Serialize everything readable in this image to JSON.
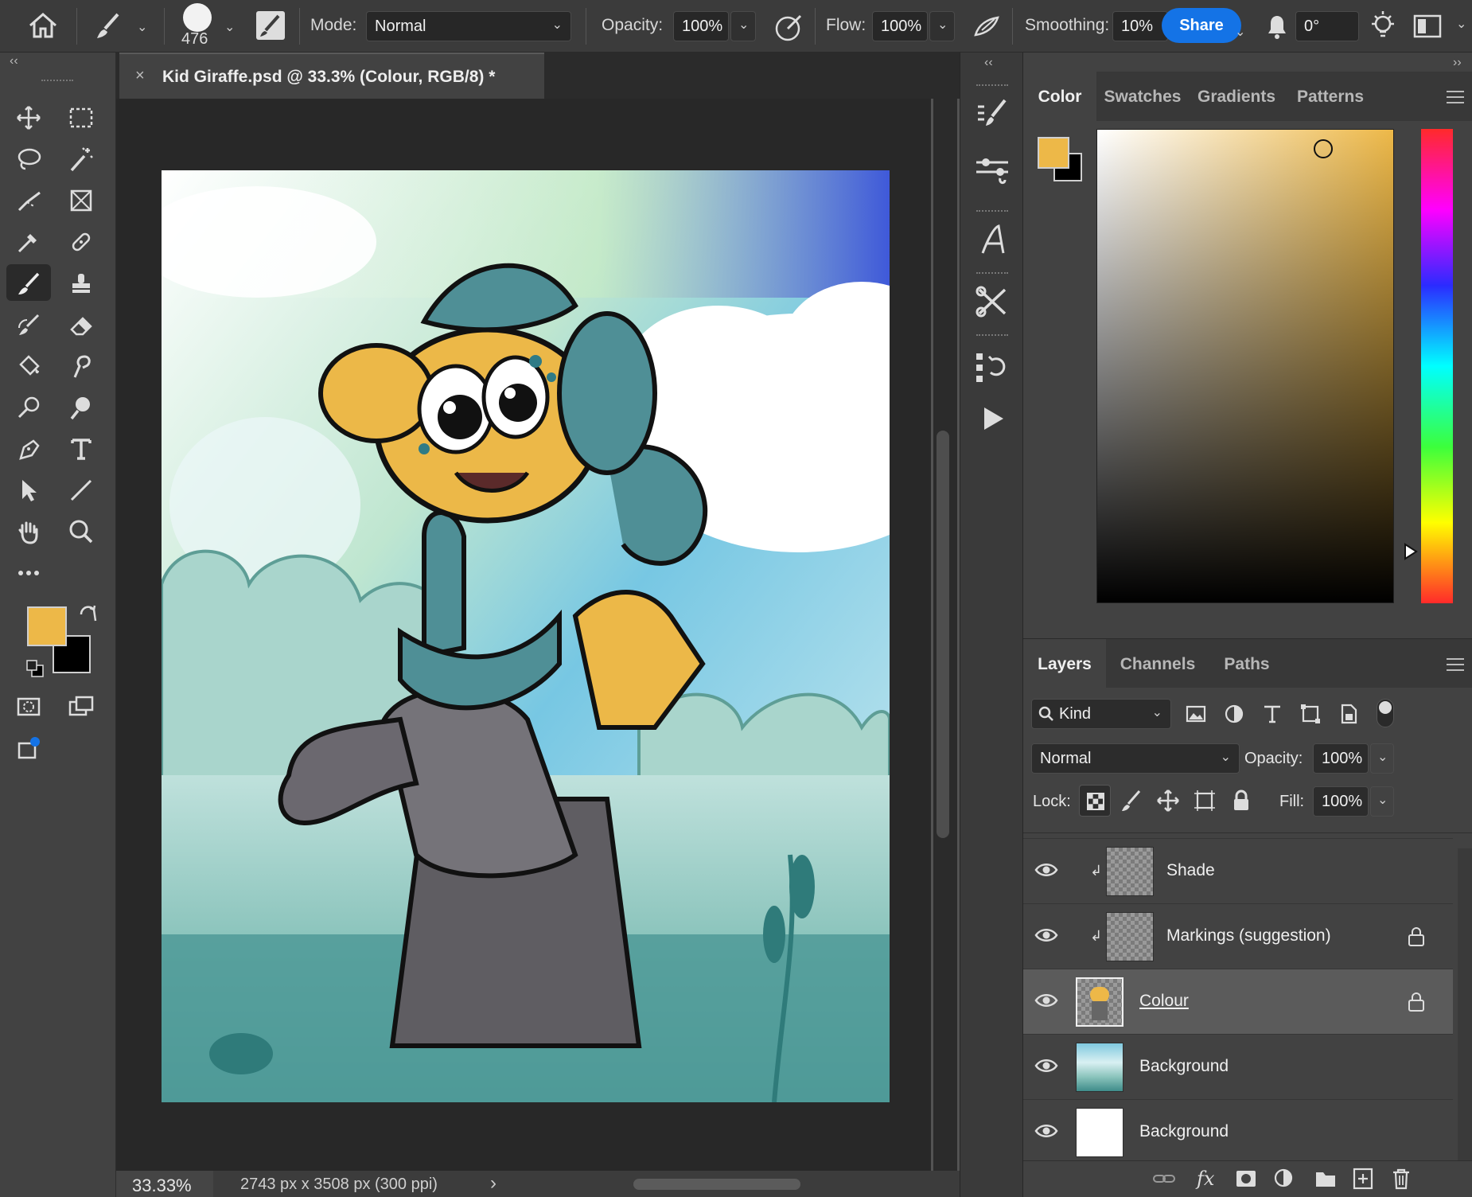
{
  "options_bar": {
    "brush_size": "476",
    "mode_label": "Mode:",
    "mode_value": "Normal",
    "opacity_label": "Opacity:",
    "opacity_value": "100%",
    "flow_label": "Flow:",
    "flow_value": "100%",
    "smoothing_label": "Smoothing:",
    "smoothing_value": "10%",
    "share_label": "Share",
    "angle_value": "0°"
  },
  "document": {
    "tab_title": "Kid Giraffe.psd @ 33.3% (Colour, RGB/8) *",
    "close_glyph": "×"
  },
  "status": {
    "zoom": "33.33%",
    "doc_info": "2743 px x 3508 px (300 ppi)",
    "arrow": "›"
  },
  "colors": {
    "foreground": "#edb848",
    "background": "#000000",
    "accent": "#1473e6"
  },
  "color_panel": {
    "tabs": [
      "Color",
      "Swatches",
      "Gradients",
      "Patterns"
    ]
  },
  "layers_panel": {
    "tabs": [
      "Layers",
      "Channels",
      "Paths"
    ],
    "filter_label": "Kind",
    "blend_mode": "Normal",
    "opacity_label": "Opacity:",
    "opacity_value": "100%",
    "lock_label": "Lock:",
    "fill_label": "Fill:",
    "fill_value": "100%",
    "layers": [
      {
        "name": "Shade",
        "clipped": true,
        "locked": false,
        "selected": false
      },
      {
        "name": "Markings (suggestion)",
        "clipped": true,
        "locked": true,
        "selected": false
      },
      {
        "name": "Colour",
        "clipped": false,
        "locked": true,
        "selected": true
      },
      {
        "name": "Background",
        "clipped": false,
        "locked": false,
        "selected": false
      },
      {
        "name": "Background",
        "clipped": false,
        "locked": false,
        "selected": false
      }
    ],
    "footer_fx": "fx"
  },
  "panel_collapse": {
    "left": "‹‹",
    "right": "››"
  }
}
